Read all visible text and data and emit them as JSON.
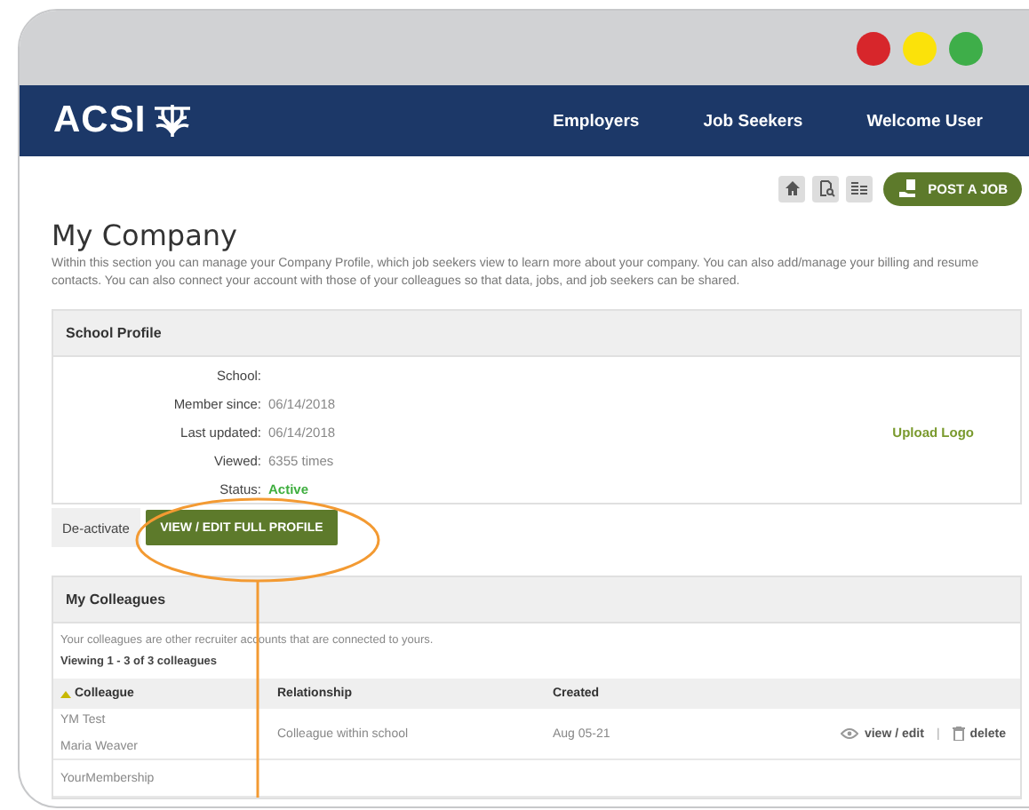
{
  "window_controls": [
    {
      "color": "#d7262b"
    },
    {
      "color": "#fbe20a"
    },
    {
      "color": "#3eae49"
    }
  ],
  "nav": {
    "logo": "ACSI",
    "items": [
      "Employers",
      "Job Seekers",
      "Welcome User"
    ]
  },
  "toolbar": {
    "post_job": "POST A JOB"
  },
  "page": {
    "title": "My Company",
    "description": "Within this section you can manage your Company Profile, which job seekers view to learn more about your company. You can also add/manage your billing and resume contacts. You can also connect your account with those of your colleagues so that data, jobs, and job seekers can be shared."
  },
  "school_profile": {
    "title": "School Profile",
    "fields": [
      {
        "label": "School:",
        "kind": "text"
      },
      {
        "label": "Member since:",
        "value": "06/14/2018",
        "kind": "text"
      },
      {
        "label": "Last updated:",
        "value": "06/14/2018",
        "kind": "text"
      },
      {
        "label": "Viewed:",
        "value": "6355 times",
        "kind": "text"
      },
      {
        "label": "Status:",
        "value": "Active",
        "kind": "status"
      }
    ],
    "upload_link": "Upload Logo",
    "deactivate": "De-activate",
    "view_edit": "VIEW / EDIT FULL PROFILE"
  },
  "colleagues": {
    "title": "My Colleagues",
    "intro": "Your colleagues are other recruiter accounts that are connected to yours.",
    "viewing": "Viewing 1 - 3 of 3 colleagues",
    "columns": [
      {
        "label": "Colleague",
        "sorted": true
      },
      {
        "label": "Relationship",
        "sorted": false
      },
      {
        "label": "Created",
        "sorted": false
      }
    ],
    "rows": [
      {
        "names": [
          "YM Test",
          "Maria Weaver"
        ],
        "relationship": "Colleague within school",
        "created": "Aug 05-21",
        "view": "view / edit",
        "separator": "|",
        "delete": "delete"
      },
      {
        "names": [
          "YourMembership"
        ]
      }
    ]
  }
}
